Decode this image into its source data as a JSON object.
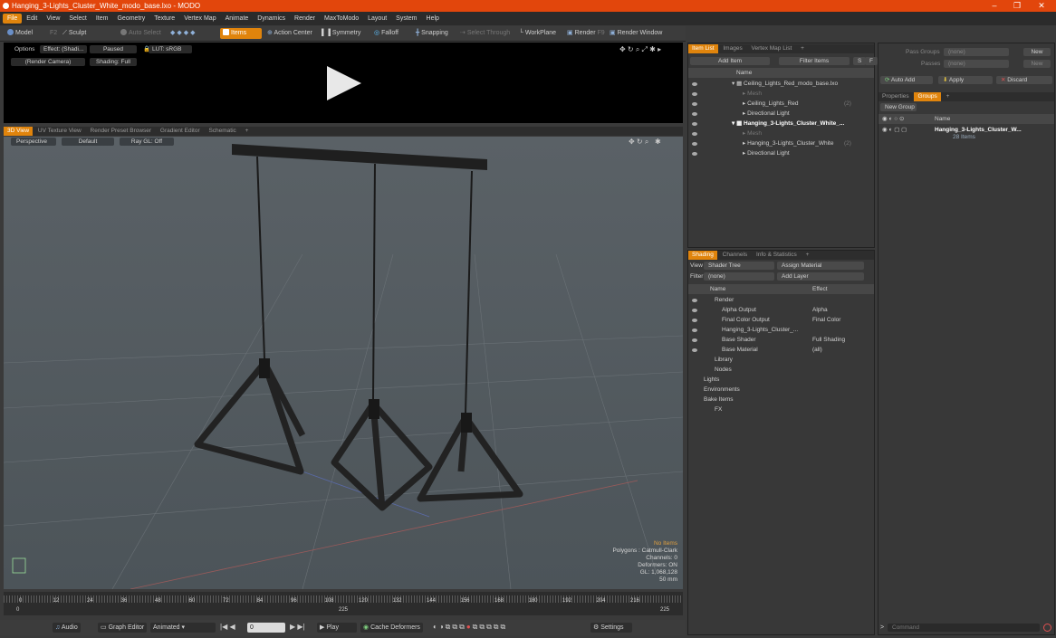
{
  "window": {
    "title": "Hanging_3-Lights_Cluster_White_modo_base.lxo - MODO",
    "controls": [
      "–",
      "❐",
      "✕"
    ]
  },
  "menu": [
    "File",
    "Edit",
    "View",
    "Select",
    "Item",
    "Geometry",
    "Texture",
    "Vertex Map",
    "Animate",
    "Dynamics",
    "Render",
    "MaxToModo",
    "Layout",
    "System",
    "Help"
  ],
  "toolbar": {
    "model": "Model",
    "f2": "F2",
    "sculpt": "Sculpt",
    "auto_select": "Auto Select",
    "items": "Items",
    "action_center": "Action Center",
    "symmetry": "Symmetry",
    "falloff": "Falloff",
    "snapping": "Snapping",
    "select_through": "Select Through",
    "workplane": "WorkPlane",
    "render": "Render",
    "f9": "F9",
    "render_window": "Render Window"
  },
  "preview": {
    "options": "Options",
    "effect": "Effect: (Shadi...",
    "paused": "Paused",
    "lut": "LUT: sRGB",
    "camera": "(Render Camera)",
    "shading": "Shading: Full"
  },
  "viewport_tabs": [
    "3D View",
    "UV Texture View",
    "Render Preset Browser",
    "Gradient Editor",
    "Schematic",
    "+"
  ],
  "viewport": {
    "perspective": "Perspective",
    "default": "Default",
    "raygl": "Ray GL: Off",
    "info": [
      "No Items",
      "Polygons : Catmull-Clark",
      "Channels: 0",
      "Deformers: ON",
      "GL: 1,068,128",
      "50 mm"
    ]
  },
  "timeline": {
    "ticks": [
      "0",
      "12",
      "24",
      "36",
      "48",
      "60",
      "72",
      "84",
      "96",
      "108",
      "120",
      "132",
      "144",
      "156",
      "168",
      "180",
      "192",
      "204",
      "216"
    ],
    "mid": "225",
    "end": "225",
    "start": "0"
  },
  "bottom": {
    "audio": "Audio",
    "graph_editor": "Graph Editor",
    "animated": "Animated",
    "frame": "0",
    "play": "Play",
    "cache": "Cache Deformers",
    "settings": "Settings"
  },
  "item_list": {
    "tabs": [
      "Item List",
      "Images",
      "Vertex Map List",
      "+"
    ],
    "add_item": "Add Item",
    "filter_items": "Filter Items",
    "s": "S",
    "f": "F",
    "name_col": "Name",
    "rows": [
      {
        "label": "Ceiling_Lights_Red_modo_base.lxo",
        "indent": 0,
        "style": "normal"
      },
      {
        "label": "Mesh",
        "indent": 1,
        "style": "dim"
      },
      {
        "label": "Ceiling_Lights_Red",
        "suffix": "(2)",
        "indent": 1,
        "style": "normal"
      },
      {
        "label": "Directional Light",
        "indent": 1,
        "style": "normal"
      },
      {
        "label": "Hanging_3-Lights_Cluster_White_...",
        "indent": 0,
        "style": "bold"
      },
      {
        "label": "Mesh",
        "indent": 1,
        "style": "dim"
      },
      {
        "label": "Hanging_3-Lights_Cluster_White",
        "suffix": "(2)",
        "indent": 1,
        "style": "normal"
      },
      {
        "label": "Directional Light",
        "indent": 1,
        "style": "normal"
      }
    ]
  },
  "shading": {
    "tabs": [
      "Shading",
      "Channels",
      "Info & Statistics",
      "+"
    ],
    "view_label": "View",
    "view_value": "Shader Tree",
    "assign_material": "Assign Material",
    "filter_label": "Filter",
    "filter_value": "(none)",
    "add_layer": "Add Layer",
    "name_col": "Name",
    "effect_col": "Effect",
    "rows": [
      {
        "label": "Render",
        "effect": "",
        "indent": 0
      },
      {
        "label": "Alpha Output",
        "effect": "Alpha",
        "indent": 1
      },
      {
        "label": "Final Color Output",
        "effect": "Final Color",
        "indent": 1
      },
      {
        "label": "Hanging_3-Lights_Cluster_...",
        "effect": "",
        "indent": 1
      },
      {
        "label": "Base Shader",
        "effect": "Full Shading",
        "indent": 1
      },
      {
        "label": "Base Material",
        "effect": "(all)",
        "indent": 1
      },
      {
        "label": "Library",
        "effect": "",
        "indent": 0
      },
      {
        "label": "Nodes",
        "effect": "",
        "indent": 0
      },
      {
        "label": "Lights",
        "effect": "",
        "indent": -1
      },
      {
        "label": "Environments",
        "effect": "",
        "indent": -1
      },
      {
        "label": "Bake Items",
        "effect": "",
        "indent": -1
      },
      {
        "label": "FX",
        "effect": "",
        "indent": 0
      }
    ]
  },
  "right": {
    "pass_groups": "Pass Groups",
    "passes": "Passes",
    "none": "(none)",
    "new": "New",
    "auto_add": "Auto Add",
    "apply": "Apply",
    "discard": "Discard",
    "tabs": [
      "Properties",
      "Groups",
      "+"
    ],
    "new_group": "New Group",
    "name_col": "Name",
    "group_name": "Hanging_3-Lights_Cluster_W...",
    "group_items": "28 Items",
    "command": "Command"
  }
}
